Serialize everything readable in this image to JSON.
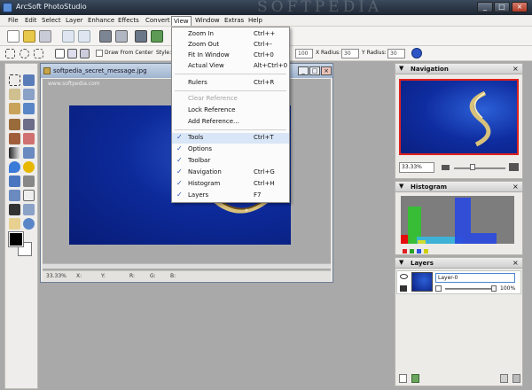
{
  "window": {
    "title": "ArcSoft PhotoStudio",
    "watermark": "SOFTPEDIA",
    "btn_min": "_",
    "btn_max": "□",
    "btn_close": "×"
  },
  "menu": [
    "File",
    "Edit",
    "Select",
    "Layer",
    "Enhance",
    "Effects",
    "Convert",
    "View",
    "Window",
    "Extras",
    "Help"
  ],
  "active_menu": "View",
  "view_menu": {
    "items": [
      {
        "label": "Zoom In",
        "shortcut": "Ctrl++"
      },
      {
        "label": "Zoom Out",
        "shortcut": "Ctrl+-"
      },
      {
        "label": "Fit In Window",
        "shortcut": "Ctrl+0"
      },
      {
        "label": "Actual View",
        "shortcut": "Alt+Ctrl+0"
      },
      {
        "label": "Rulers",
        "shortcut": "Ctrl+R"
      },
      {
        "label": "Clear Reference",
        "shortcut": ""
      },
      {
        "label": "Lock Reference",
        "shortcut": ""
      },
      {
        "label": "Add Reference...",
        "shortcut": ""
      },
      {
        "label": "Tools",
        "shortcut": "Ctrl+T"
      },
      {
        "label": "Options",
        "shortcut": ""
      },
      {
        "label": "Toolbar",
        "shortcut": ""
      },
      {
        "label": "Navigation",
        "shortcut": "Ctrl+G"
      },
      {
        "label": "Histogram",
        "shortcut": "Ctrl+H"
      },
      {
        "label": "Layers",
        "shortcut": "F7"
      }
    ],
    "check": "✓"
  },
  "options_bar": {
    "draw_from_center": "Draw From Center",
    "style_label": "Style:",
    "width_value": "100",
    "x_radius_label": "X Radius:",
    "x_radius_value": "30",
    "y_radius_label": "Y Radius:",
    "y_radius_value": "30"
  },
  "document": {
    "title": "softpedia_secret_message.jpg",
    "watermark": "www.softpedia.com",
    "zoom": "33.33%",
    "status": {
      "x": "X:",
      "y": "Y:",
      "r": "R:",
      "g": "G:",
      "b": "B:"
    }
  },
  "navigation": {
    "title": "Navigation",
    "zoom": "33.33%",
    "zoom_level": 0.35
  },
  "histogram": {
    "title": "Histogram",
    "bars": [
      {
        "color": "#f20000",
        "from": 0.0,
        "to": 0.08,
        "height": 0.18
      },
      {
        "color": "#31c430",
        "from": 0.06,
        "to": 0.18,
        "height": 0.78
      },
      {
        "color": "#36b8e0",
        "from": 0.14,
        "to": 0.55,
        "height": 0.14
      },
      {
        "color": "#e0e020",
        "from": 0.15,
        "to": 0.22,
        "height": 0.08
      },
      {
        "color": "#2a48e0",
        "from": 0.48,
        "to": 0.62,
        "height": 0.96
      },
      {
        "color": "#2a48e0",
        "from": 0.62,
        "to": 0.85,
        "height": 0.22
      }
    ],
    "channel_colors": [
      "#e02020",
      "#2aa02a",
      "#2a50e0",
      "#d0d000"
    ]
  },
  "layers": {
    "title": "Layers",
    "layer_name": "Layer-0",
    "opacity": "100%",
    "opacity_value": 1.0
  },
  "panel_arrow": "▼",
  "panel_close": "×",
  "colors": {
    "fg": "#000000",
    "bg": "#ffffff",
    "accent": "#2a57b5"
  }
}
